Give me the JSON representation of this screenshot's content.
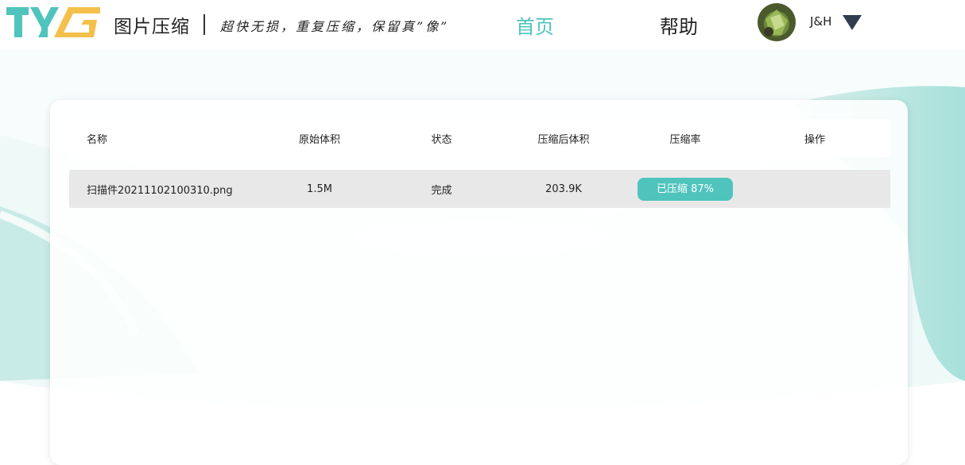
{
  "header": {
    "app_title": "图片压缩",
    "slogan": "超快无损，重复压缩，保留真”像”",
    "nav": {
      "home": "首页",
      "help": "帮助"
    },
    "user": {
      "name": "J&H"
    }
  },
  "table": {
    "columns": [
      "名称",
      "原始体积",
      "状态",
      "压缩后体积",
      "压缩率",
      "操作"
    ],
    "rows": [
      {
        "name": "扫描件20211102100310.png",
        "original_size": "1.5M",
        "status": "完成",
        "compressed_size": "203.9K",
        "rate": "已压缩 87%",
        "action": ""
      }
    ]
  },
  "colors": {
    "accent": "#4fc4bc",
    "logo_yellow": "#f3c14b",
    "row_bg": "#e8e8e8",
    "dropdown": "#2f3d4f"
  },
  "icons": {
    "logo": "tyg-logo-icon",
    "avatar": "user-avatar-image",
    "dropdown": "caret-down-icon"
  }
}
